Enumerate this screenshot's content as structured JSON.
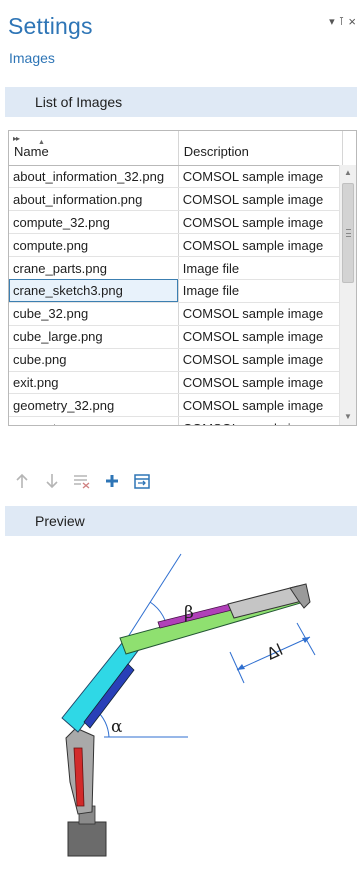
{
  "panel": {
    "title": "Settings",
    "subtitle": "Images",
    "window_controls": [
      "▾",
      "⊺",
      "×"
    ]
  },
  "list_section": {
    "label": "List of Images",
    "columns": [
      "Name",
      "Description"
    ],
    "rows": [
      {
        "name": "about_information_32.png",
        "description": "COMSOL sample image"
      },
      {
        "name": "about_information.png",
        "description": "COMSOL sample image"
      },
      {
        "name": "compute_32.png",
        "description": "COMSOL sample image"
      },
      {
        "name": "compute.png",
        "description": "COMSOL sample image"
      },
      {
        "name": "crane_parts.png",
        "description": "Image file"
      },
      {
        "name": "crane_sketch3.png",
        "description": "Image file",
        "selected": true
      },
      {
        "name": "cube_32.png",
        "description": "COMSOL sample image"
      },
      {
        "name": "cube_large.png",
        "description": "COMSOL sample image"
      },
      {
        "name": "cube.png",
        "description": "COMSOL sample image"
      },
      {
        "name": "exit.png",
        "description": "COMSOL sample image"
      },
      {
        "name": "geometry_32.png",
        "description": "COMSOL sample image"
      },
      {
        "name": "geometry.png",
        "description": "COMSOL sample image"
      }
    ],
    "toolbar": [
      "move-up-icon",
      "move-down-icon",
      "clear-list-icon",
      "add-icon",
      "import-icon"
    ]
  },
  "preview_section": {
    "label": "Preview",
    "image_labels": {
      "beta": "β",
      "alpha": "α",
      "delta_l": "Δl"
    }
  },
  "colors": {
    "accent": "#2e75b6",
    "section_bar": "#dfe9f5",
    "selected_outline": "#3c7fb1"
  }
}
